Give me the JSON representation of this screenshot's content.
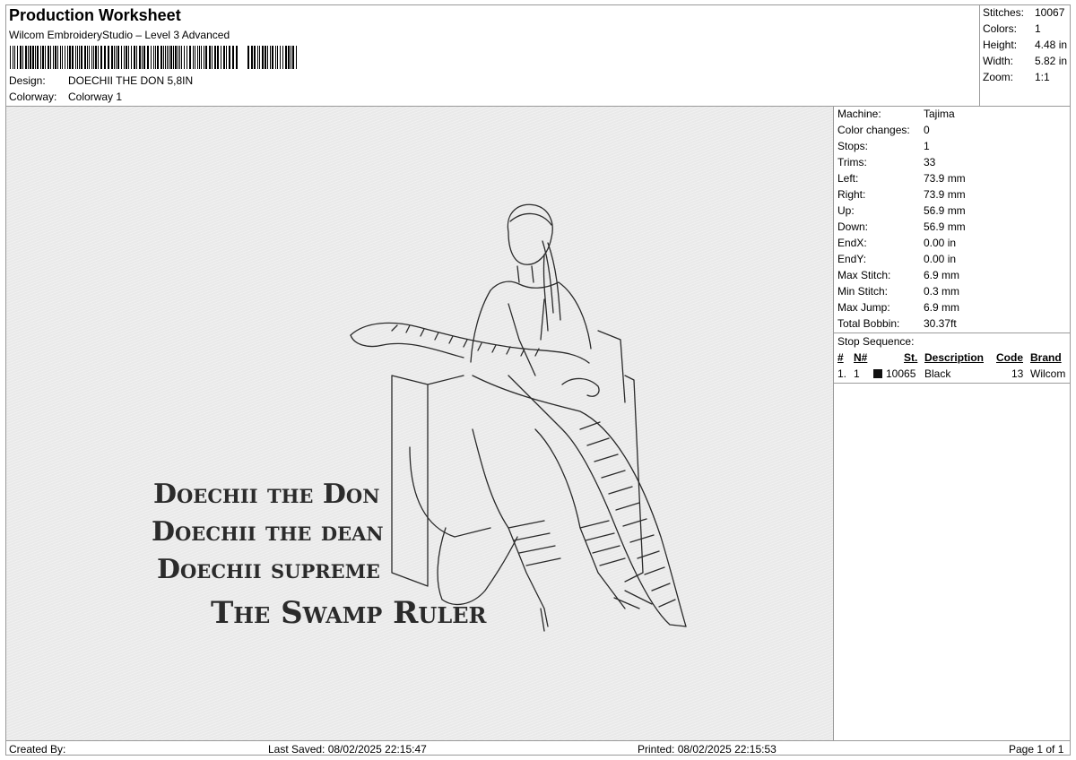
{
  "header": {
    "title": "Production Worksheet",
    "software": "Wilcom EmbroideryStudio – Level 3 Advanced",
    "design_label": "Design:",
    "design_value": "DOECHII THE DON 5,8IN",
    "colorway_label": "Colorway:",
    "colorway_value": "Colorway 1"
  },
  "summary": [
    {
      "label": "Stitches:",
      "value": "10067"
    },
    {
      "label": "Colors:",
      "value": "1"
    },
    {
      "label": "Height:",
      "value": "4.48 in"
    },
    {
      "label": "Width:",
      "value": "5.82 in"
    },
    {
      "label": "Zoom:",
      "value": "1:1"
    }
  ],
  "details": [
    {
      "label": "Machine:",
      "value": "Tajima"
    },
    {
      "label": "Color changes:",
      "value": "0"
    },
    {
      "label": "Stops:",
      "value": "1"
    },
    {
      "label": "Trims:",
      "value": "33"
    },
    {
      "label": "Left:",
      "value": "73.9 mm"
    },
    {
      "label": "Right:",
      "value": "73.9 mm"
    },
    {
      "label": "Up:",
      "value": "56.9 mm"
    },
    {
      "label": "Down:",
      "value": "56.9 mm"
    },
    {
      "label": "EndX:",
      "value": "0.00 in"
    },
    {
      "label": "EndY:",
      "value": "0.00 in"
    },
    {
      "label": "Max Stitch:",
      "value": "6.9 mm"
    },
    {
      "label": "Min Stitch:",
      "value": "0.3 mm"
    },
    {
      "label": "Max Jump:",
      "value": "6.9 mm"
    },
    {
      "label": "Total Bobbin:",
      "value": "30.37ft"
    }
  ],
  "stop_sequence": {
    "title": "Stop Sequence:",
    "columns": [
      "#",
      "N#",
      "St.",
      "Description",
      "Code",
      "Brand"
    ],
    "rows": [
      {
        "index": "1.",
        "needle": "1",
        "stitches": "10065",
        "description": "Black",
        "code": "13",
        "brand": "Wilcom",
        "color": "#111111"
      }
    ]
  },
  "design_text": {
    "line1": "Doechii the Don",
    "line2": "Doechii the dean",
    "line3": "Doechii supreme",
    "line4": "The Swamp Ruler"
  },
  "footer": {
    "created_by": "Created By:",
    "last_saved": "Last Saved: 08/02/2025 22:15:47",
    "printed": "Printed: 08/02/2025 22:15:53",
    "page": "Page 1 of 1"
  }
}
